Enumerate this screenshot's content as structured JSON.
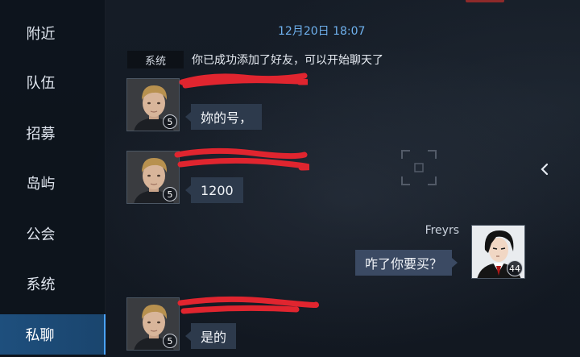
{
  "sidebar": {
    "items": [
      {
        "label": "附近"
      },
      {
        "label": "队伍"
      },
      {
        "label": "招募"
      },
      {
        "label": "岛屿"
      },
      {
        "label": "公会"
      },
      {
        "label": "系统"
      },
      {
        "label": "私聊",
        "active": true
      }
    ]
  },
  "chat": {
    "timestamp": "12月20日 18:07",
    "system_tag": "系统",
    "system_message": "你已成功添加了好友，可以开始聊天了",
    "messages": [
      {
        "from": "friend",
        "level": "5",
        "text": "妳的号，"
      },
      {
        "from": "friend",
        "level": "5",
        "text": "1200"
      },
      {
        "from": "me",
        "sender": "Freyrs",
        "level": "44",
        "text": "咋了你要买？"
      },
      {
        "from": "friend",
        "level": "5",
        "text": "是的"
      }
    ]
  },
  "colors": {
    "sidebar_active": "#1e4f7d",
    "timestamp": "#6fb1ee",
    "bubble": "#2d3a4c",
    "scribble": "#e0252f"
  },
  "icons": {
    "collapse": "chevron-left-icon",
    "target": "target-frame-icon"
  }
}
